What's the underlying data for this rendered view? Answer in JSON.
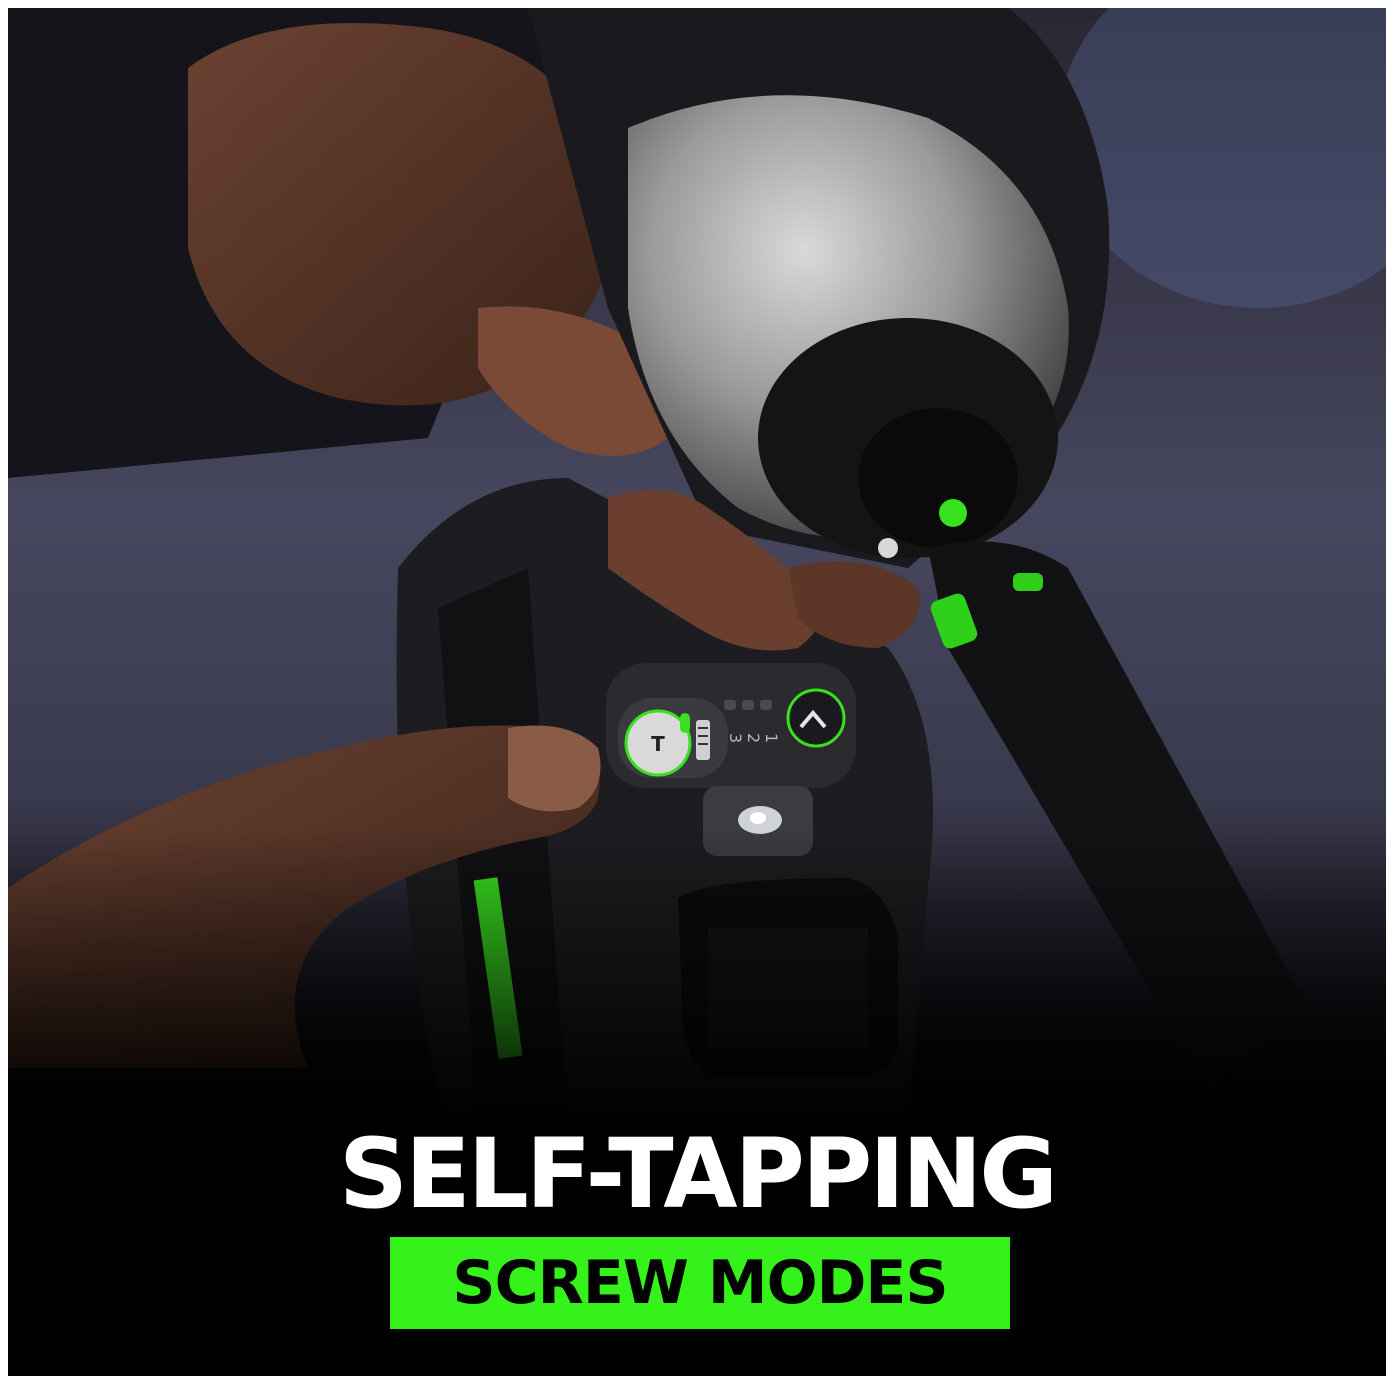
{
  "headline": "SELF-TAPPING",
  "subheadline": "SCREW MODES",
  "colors": {
    "accent_green": "#35f21a",
    "background": "#000000",
    "text": "#ffffff"
  },
  "tool_panel": {
    "speed_labels": [
      "3",
      "2",
      "1"
    ],
    "button_letter": "T",
    "icons": [
      "self-tapping-mode-button-icon",
      "screw-mode-icon",
      "mode-select-chevron-icon",
      "work-light-icon"
    ]
  }
}
